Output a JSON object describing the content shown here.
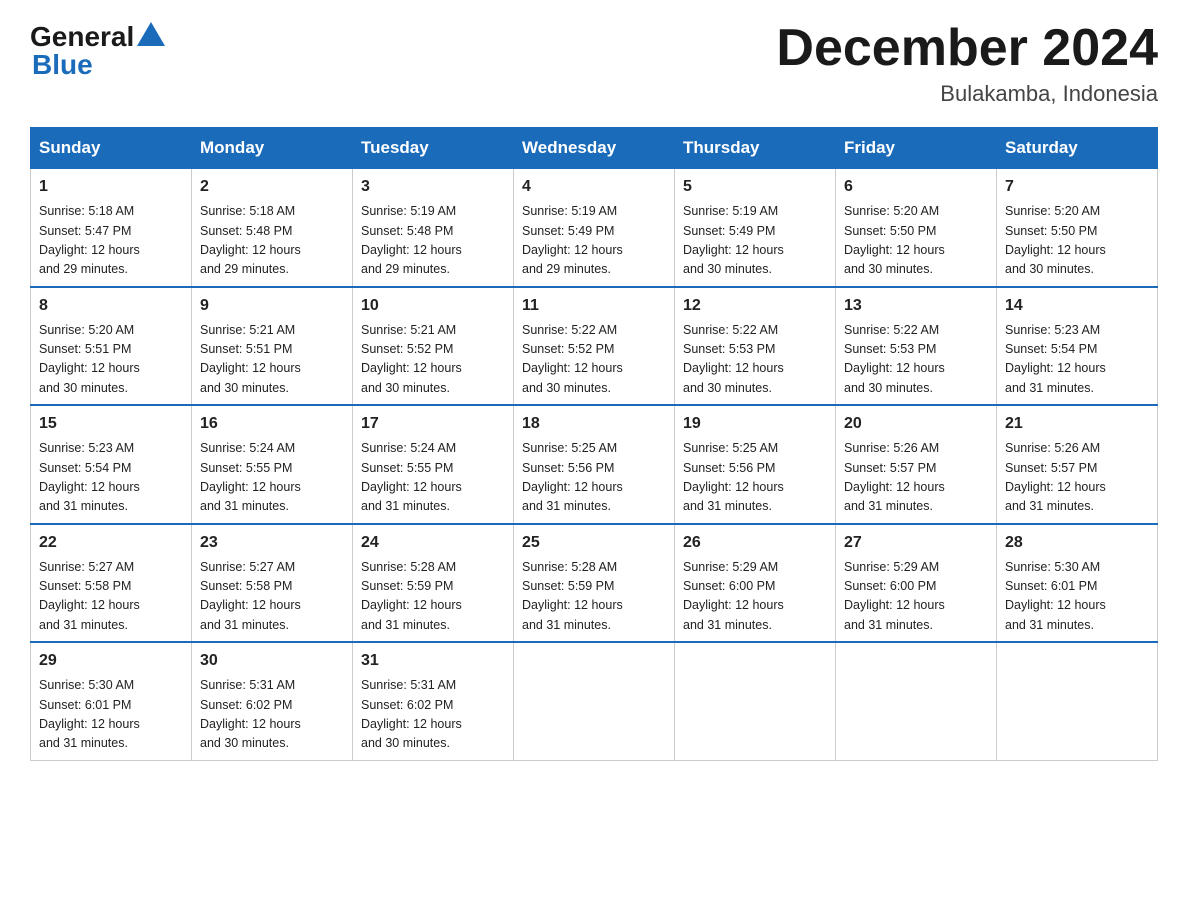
{
  "header": {
    "logo_general": "General",
    "logo_blue": "Blue",
    "month_year": "December 2024",
    "location": "Bulakamba, Indonesia"
  },
  "calendar": {
    "days_of_week": [
      "Sunday",
      "Monday",
      "Tuesday",
      "Wednesday",
      "Thursday",
      "Friday",
      "Saturday"
    ],
    "weeks": [
      [
        {
          "day": "1",
          "sunrise": "5:18 AM",
          "sunset": "5:47 PM",
          "daylight": "12 hours and 29 minutes."
        },
        {
          "day": "2",
          "sunrise": "5:18 AM",
          "sunset": "5:48 PM",
          "daylight": "12 hours and 29 minutes."
        },
        {
          "day": "3",
          "sunrise": "5:19 AM",
          "sunset": "5:48 PM",
          "daylight": "12 hours and 29 minutes."
        },
        {
          "day": "4",
          "sunrise": "5:19 AM",
          "sunset": "5:49 PM",
          "daylight": "12 hours and 29 minutes."
        },
        {
          "day": "5",
          "sunrise": "5:19 AM",
          "sunset": "5:49 PM",
          "daylight": "12 hours and 30 minutes."
        },
        {
          "day": "6",
          "sunrise": "5:20 AM",
          "sunset": "5:50 PM",
          "daylight": "12 hours and 30 minutes."
        },
        {
          "day": "7",
          "sunrise": "5:20 AM",
          "sunset": "5:50 PM",
          "daylight": "12 hours and 30 minutes."
        }
      ],
      [
        {
          "day": "8",
          "sunrise": "5:20 AM",
          "sunset": "5:51 PM",
          "daylight": "12 hours and 30 minutes."
        },
        {
          "day": "9",
          "sunrise": "5:21 AM",
          "sunset": "5:51 PM",
          "daylight": "12 hours and 30 minutes."
        },
        {
          "day": "10",
          "sunrise": "5:21 AM",
          "sunset": "5:52 PM",
          "daylight": "12 hours and 30 minutes."
        },
        {
          "day": "11",
          "sunrise": "5:22 AM",
          "sunset": "5:52 PM",
          "daylight": "12 hours and 30 minutes."
        },
        {
          "day": "12",
          "sunrise": "5:22 AM",
          "sunset": "5:53 PM",
          "daylight": "12 hours and 30 minutes."
        },
        {
          "day": "13",
          "sunrise": "5:22 AM",
          "sunset": "5:53 PM",
          "daylight": "12 hours and 30 minutes."
        },
        {
          "day": "14",
          "sunrise": "5:23 AM",
          "sunset": "5:54 PM",
          "daylight": "12 hours and 31 minutes."
        }
      ],
      [
        {
          "day": "15",
          "sunrise": "5:23 AM",
          "sunset": "5:54 PM",
          "daylight": "12 hours and 31 minutes."
        },
        {
          "day": "16",
          "sunrise": "5:24 AM",
          "sunset": "5:55 PM",
          "daylight": "12 hours and 31 minutes."
        },
        {
          "day": "17",
          "sunrise": "5:24 AM",
          "sunset": "5:55 PM",
          "daylight": "12 hours and 31 minutes."
        },
        {
          "day": "18",
          "sunrise": "5:25 AM",
          "sunset": "5:56 PM",
          "daylight": "12 hours and 31 minutes."
        },
        {
          "day": "19",
          "sunrise": "5:25 AM",
          "sunset": "5:56 PM",
          "daylight": "12 hours and 31 minutes."
        },
        {
          "day": "20",
          "sunrise": "5:26 AM",
          "sunset": "5:57 PM",
          "daylight": "12 hours and 31 minutes."
        },
        {
          "day": "21",
          "sunrise": "5:26 AM",
          "sunset": "5:57 PM",
          "daylight": "12 hours and 31 minutes."
        }
      ],
      [
        {
          "day": "22",
          "sunrise": "5:27 AM",
          "sunset": "5:58 PM",
          "daylight": "12 hours and 31 minutes."
        },
        {
          "day": "23",
          "sunrise": "5:27 AM",
          "sunset": "5:58 PM",
          "daylight": "12 hours and 31 minutes."
        },
        {
          "day": "24",
          "sunrise": "5:28 AM",
          "sunset": "5:59 PM",
          "daylight": "12 hours and 31 minutes."
        },
        {
          "day": "25",
          "sunrise": "5:28 AM",
          "sunset": "5:59 PM",
          "daylight": "12 hours and 31 minutes."
        },
        {
          "day": "26",
          "sunrise": "5:29 AM",
          "sunset": "6:00 PM",
          "daylight": "12 hours and 31 minutes."
        },
        {
          "day": "27",
          "sunrise": "5:29 AM",
          "sunset": "6:00 PM",
          "daylight": "12 hours and 31 minutes."
        },
        {
          "day": "28",
          "sunrise": "5:30 AM",
          "sunset": "6:01 PM",
          "daylight": "12 hours and 31 minutes."
        }
      ],
      [
        {
          "day": "29",
          "sunrise": "5:30 AM",
          "sunset": "6:01 PM",
          "daylight": "12 hours and 31 minutes."
        },
        {
          "day": "30",
          "sunrise": "5:31 AM",
          "sunset": "6:02 PM",
          "daylight": "12 hours and 30 minutes."
        },
        {
          "day": "31",
          "sunrise": "5:31 AM",
          "sunset": "6:02 PM",
          "daylight": "12 hours and 30 minutes."
        },
        null,
        null,
        null,
        null
      ]
    ]
  }
}
